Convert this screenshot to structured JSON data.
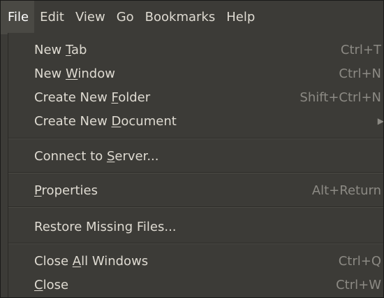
{
  "menubar": {
    "items": [
      {
        "label": "File",
        "active": true
      },
      {
        "label": "Edit"
      },
      {
        "label": "View"
      },
      {
        "label": "Go"
      },
      {
        "label": "Bookmarks"
      },
      {
        "label": "Help"
      }
    ]
  },
  "file_menu": {
    "new_tab": {
      "pre": "New ",
      "mn": "T",
      "post": "ab",
      "shortcut": "Ctrl+T"
    },
    "new_window": {
      "pre": "New ",
      "mn": "W",
      "post": "indow",
      "shortcut": "Ctrl+N"
    },
    "create_new_folder": {
      "pre": "Create New ",
      "mn": "F",
      "post": "older",
      "shortcut": "Shift+Ctrl+N"
    },
    "create_new_document": {
      "pre": "Create New ",
      "mn": "D",
      "post": "ocument",
      "submenu_icon": "arrow-right-icon"
    },
    "connect_to_server": {
      "pre": "Connect to ",
      "mn": "S",
      "post": "erver..."
    },
    "properties": {
      "pre": "",
      "mn": "P",
      "post": "roperties",
      "shortcut": "Alt+Return"
    },
    "restore_missing_files": {
      "label": "Restore Missing Files..."
    },
    "close_all_windows": {
      "pre": "Close ",
      "mn": "A",
      "post": "ll Windows",
      "shortcut": "Ctrl+Q"
    },
    "close": {
      "pre": "",
      "mn": "C",
      "post": "lose",
      "shortcut": "Ctrl+W"
    }
  },
  "colors": {
    "background": "#3c3b37",
    "text": "#dfdbd2",
    "shortcut_text": "#8c8a84",
    "active_menubar_bg": "#4a4944"
  }
}
